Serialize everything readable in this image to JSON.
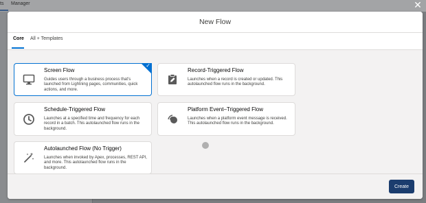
{
  "background_app": {
    "tabs": [
      {
        "label": "ts"
      },
      {
        "label": "Manager"
      }
    ]
  },
  "modal": {
    "title": "New Flow",
    "tabs": [
      {
        "label": "Core",
        "selected": true
      },
      {
        "label": "All + Templates",
        "selected": false
      }
    ],
    "flow_types": [
      {
        "title": "Screen Flow",
        "description": "Guides users through a business process that's launched from Lightning pages, communities, quick actions, and more.",
        "icon": "monitor-icon",
        "selected": true
      },
      {
        "title": "Record-Triggered Flow",
        "description": "Launches when a record is created or updated. This autolaunched flow runs in the background.",
        "icon": "record-edit-icon",
        "selected": false
      },
      {
        "title": "Schedule-Triggered Flow",
        "description": "Launches at a specified time and frequency for each record in a batch. This autolaunched flow runs in the background.",
        "icon": "clock-icon",
        "selected": false
      },
      {
        "title": "Platform Event–Triggered Flow",
        "description": "Launches when a platform event message is received. This autolaunched flow runs in the background.",
        "icon": "broadcast-icon",
        "selected": false
      },
      {
        "title": "Autolaunched Flow (No Trigger)",
        "description": "Launches when invoked by Apex, processes, REST API, and more. This autolaunched flow runs in the background.",
        "icon": "magic-wand-icon",
        "selected": false
      }
    ],
    "footer": {
      "create_label": "Create"
    }
  },
  "colors": {
    "brand": "#0070d2",
    "create_button": "#1b3d6e",
    "overlay": "#7b7d80"
  }
}
